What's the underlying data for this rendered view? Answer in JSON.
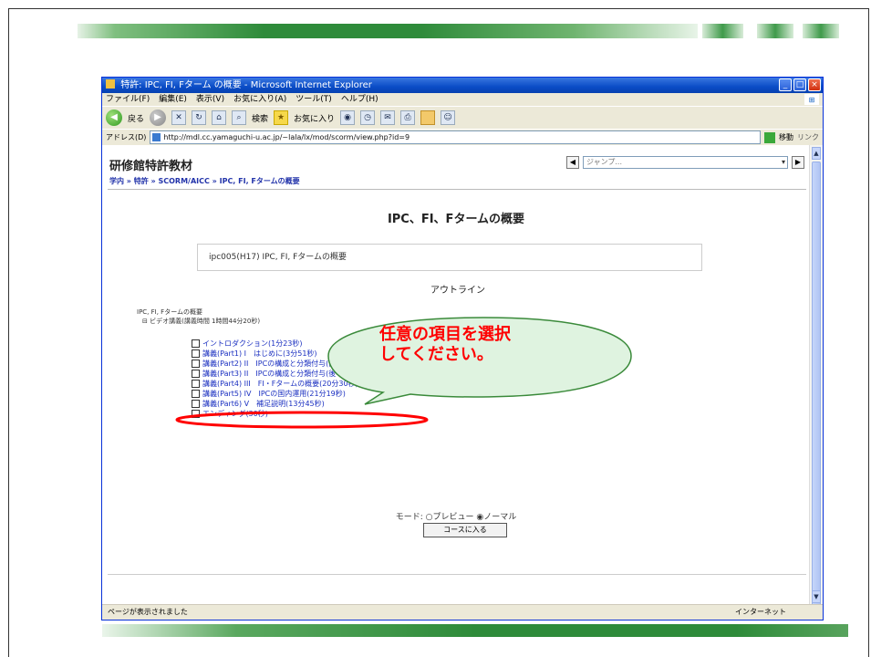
{
  "window": {
    "title": "特許: IPC, FI, Fターム の概要 - Microsoft Internet Explorer",
    "menu": [
      "ファイル(F)",
      "編集(E)",
      "表示(V)",
      "お気に入り(A)",
      "ツール(T)",
      "ヘルプ(H)"
    ],
    "toolbar": {
      "back": "戻る",
      "search": "検索",
      "favorites": "お気に入り"
    },
    "address_label": "アドレス(D)",
    "address_value": "http://mdl.cc.yamaguchi-u.ac.jp/~lala/lx/mod/scorm/view.php?id=9",
    "go_label": "移動",
    "links_label": "リンク"
  },
  "page": {
    "site_title": "研修館特許教材",
    "jump_placeholder": "ジャンプ...",
    "breadcrumb": "学内 » 特許 » SCORM/AICC » IPC, FI, Fタームの概要",
    "heading": "IPC、FI、Fタームの概要",
    "summary": "ipc005(H17) IPC, FI, Fタームの概要",
    "outline_heading": "アウトライン",
    "tree_title": "IPC, FI, Fタームの概要",
    "tree_sub": "⊟ ビデオ講義(講義時間 1時間44分20秒)",
    "lessons": [
      "イントロダクション(1分23秒)",
      "講義(Part1) I　はじめに(3分51秒)",
      "講義(Part2) II　IPCの構成と分類付与(前半)(16分58秒)",
      "講義(Part3) II　IPCの構成と分類付与(後半)(20分54秒)",
      "講義(Part4) III　FI・Fタームの概要(20分30秒)",
      "講義(Part5) IV　IPCの国内運用(21分19秒)",
      "講義(Part6) V　補足説明(13分45秒)",
      "エンディング(30秒)"
    ],
    "mode_text": "モード: ○プレビュー ◉ノーマル",
    "enter_button": "コースに入る"
  },
  "status": {
    "left": "ページが表示されました",
    "zone": "インターネット"
  },
  "callout": {
    "text": "任意の項目を選択\nしてください。",
    "text_color": "#ff0000",
    "fill": "#dff3e0",
    "stroke": "#3a8a3a"
  },
  "accent": {
    "slide_bar": "#2e8b3a",
    "highlight_ellipse": "#ff0000"
  }
}
